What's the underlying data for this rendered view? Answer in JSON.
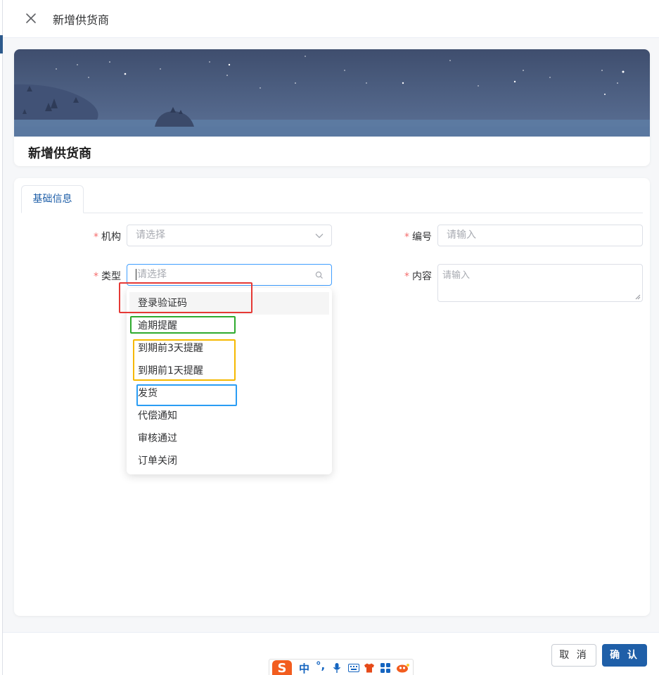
{
  "header": {
    "title": "新增供货商"
  },
  "banner": {
    "title": "新增供货商"
  },
  "tabs": [
    {
      "label": "基础信息"
    }
  ],
  "form": {
    "org": {
      "label": "机构",
      "placeholder": "请选择"
    },
    "code": {
      "label": "编号",
      "placeholder": "请输入"
    },
    "type": {
      "label": "类型",
      "placeholder": "请选择"
    },
    "content": {
      "label": "内容",
      "placeholder": "请输入"
    }
  },
  "dropdown": {
    "options": [
      "登录验证码",
      "逾期提醒",
      "到期前3天提醒",
      "到期前1天提醒",
      "发货",
      "代偿通知",
      "审核通过",
      "订单关闭"
    ],
    "hovered_index": 0
  },
  "annotations": {
    "colors": {
      "red": "#e53935",
      "green": "#2eaa2e",
      "yellow": "#f5b800",
      "blue": "#2a9df4"
    }
  },
  "footer": {
    "cancel": "取 消",
    "confirm": "确 认"
  },
  "ime": {
    "logo": "S",
    "lang": "中",
    "punct": "°,"
  },
  "colors": {
    "primary": "#1f5fa8",
    "required": "#f56c6c",
    "placeholder": "#a8abb2"
  }
}
